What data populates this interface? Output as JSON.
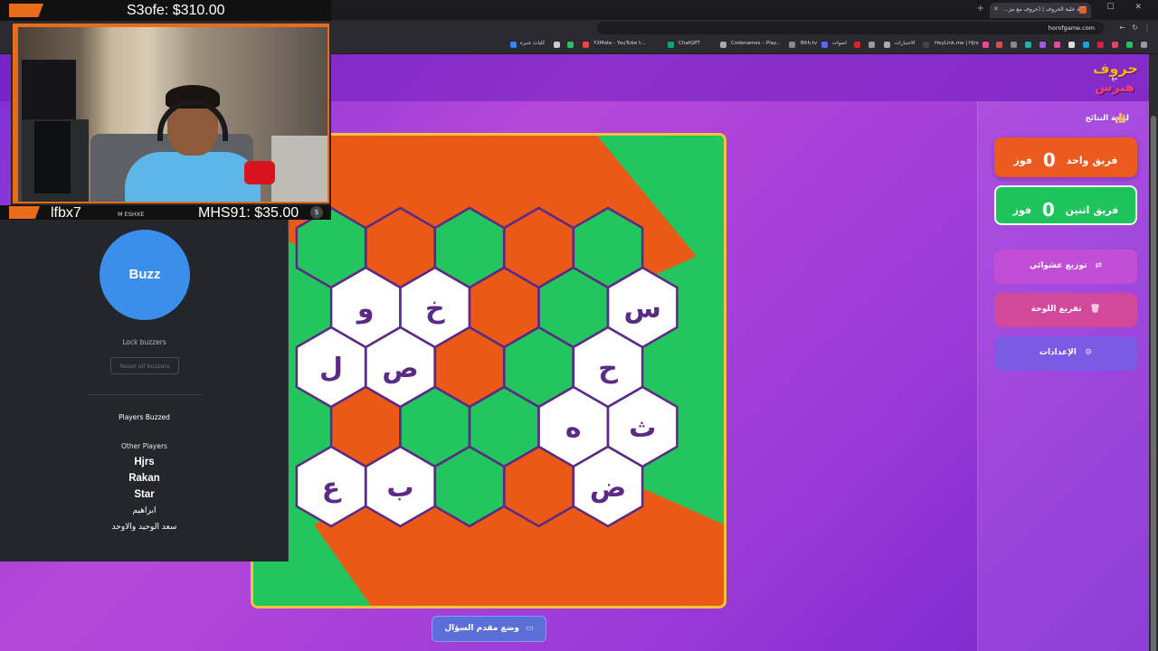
{
  "browser": {
    "tab_title": "لعبة خلية الحروف | (حروف مع مز...",
    "url": "horofgame.com",
    "bookmarks": [
      "كليات عنيزة",
      "Y2Mate - YouTube t...",
      "ChatGPT",
      "Codenames – Play...",
      "Bith.tv",
      "اصوات",
      "الاختبارات",
      "HeyLink.me | Hjrs"
    ]
  },
  "overlay": {
    "top_alert": "S3ofe: $310.00",
    "bottom_user": "lfbx7",
    "bottom_channel": "M ESHXE",
    "bottom_alert": "MHS91: $35.00"
  },
  "buzzer": {
    "buzz_label": "Buzz",
    "lock_label": "Lock buzzers",
    "reset_label": "Reset all buzzers",
    "players_buzzed_title": "Players Buzzed",
    "other_players_title": "Other Players",
    "other_players": [
      "Hjrs",
      "Rakan",
      "Star",
      "ابراهيم",
      "سعد الوحيد والاوحد"
    ]
  },
  "game": {
    "logo_line1": "حروف",
    "logo_line2": "مع",
    "logo_line3": "هبرس",
    "results_title": "لوحة النتائج",
    "team1": {
      "name": "فريق واحد",
      "score": "0",
      "unit": "فوز",
      "color": "#ec5a1f"
    },
    "team2": {
      "name": "فريق اثنين",
      "score": "0",
      "unit": "فوز",
      "color": "#1ec35c"
    },
    "actions": {
      "shuffle": "توزيع عشوائي",
      "clear": "تفريغ اللوحة",
      "settings": "الإعدادات"
    },
    "present_button": "وضع مقدم السؤال",
    "colors": {
      "orange": "#ea5a16",
      "green": "#22c55e",
      "white": "#ffffff",
      "hex_border": "#5b2a86"
    },
    "board": [
      [
        {
          "c": "green",
          "l": ""
        },
        {
          "c": "orange",
          "l": ""
        },
        {
          "c": "green",
          "l": ""
        },
        {
          "c": "orange",
          "l": ""
        },
        {
          "c": "green",
          "l": ""
        }
      ],
      [
        {
          "c": "white",
          "l": "و"
        },
        {
          "c": "white",
          "l": "خ"
        },
        {
          "c": "orange",
          "l": ""
        },
        {
          "c": "green",
          "l": ""
        },
        {
          "c": "white",
          "l": "س"
        }
      ],
      [
        {
          "c": "white",
          "l": "ل"
        },
        {
          "c": "white",
          "l": "ص"
        },
        {
          "c": "orange",
          "l": ""
        },
        {
          "c": "green",
          "l": ""
        },
        {
          "c": "white",
          "l": "ح"
        }
      ],
      [
        {
          "c": "orange",
          "l": ""
        },
        {
          "c": "green",
          "l": ""
        },
        {
          "c": "green",
          "l": ""
        },
        {
          "c": "white",
          "l": "ه"
        },
        {
          "c": "white",
          "l": "ث"
        }
      ],
      [
        {
          "c": "white",
          "l": "ع"
        },
        {
          "c": "white",
          "l": "ب"
        },
        {
          "c": "green",
          "l": ""
        },
        {
          "c": "orange",
          "l": ""
        },
        {
          "c": "white",
          "l": "ض"
        }
      ]
    ]
  }
}
